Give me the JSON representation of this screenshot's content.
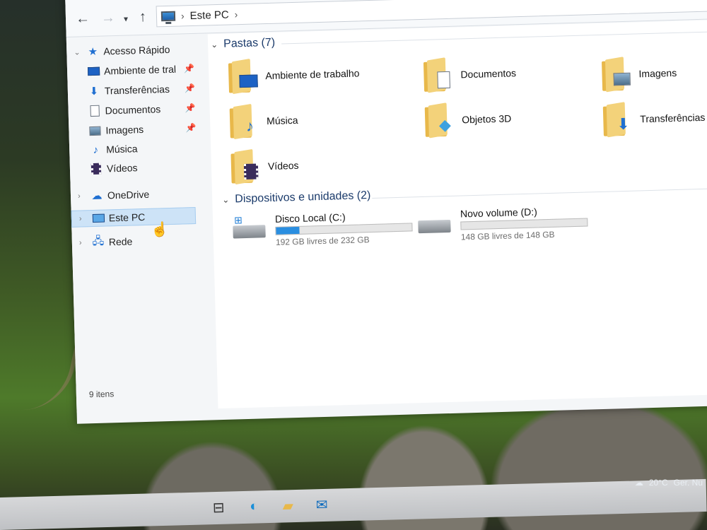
{
  "breadcrumb": {
    "location": "Este PC"
  },
  "sidebar": {
    "quick_access": "Acesso Rápido",
    "items": [
      {
        "label": "Ambiente de tral",
        "icon": "desktop-icon",
        "pinned": true
      },
      {
        "label": "Transferências",
        "icon": "download-icon",
        "pinned": true
      },
      {
        "label": "Documentos",
        "icon": "document-icon",
        "pinned": true
      },
      {
        "label": "Imagens",
        "icon": "pictures-icon",
        "pinned": true
      },
      {
        "label": "Música",
        "icon": "music-icon",
        "pinned": false
      },
      {
        "label": "Vídeos",
        "icon": "videos-icon",
        "pinned": false
      }
    ],
    "onedrive": "OneDrive",
    "este_pc": "Este PC",
    "rede": "Rede"
  },
  "main": {
    "folders_header": "Pastas (7)",
    "folders": [
      {
        "label": "Ambiente de trabalho",
        "icon": "desktop-folder-icon"
      },
      {
        "label": "Documentos",
        "icon": "documents-folder-icon"
      },
      {
        "label": "Imagens",
        "icon": "pictures-folder-icon"
      },
      {
        "label": "Música",
        "icon": "music-folder-icon"
      },
      {
        "label": "Objetos 3D",
        "icon": "3d-objects-folder-icon"
      },
      {
        "label": "Transferências",
        "icon": "downloads-folder-icon"
      },
      {
        "label": "Vídeos",
        "icon": "videos-folder-icon"
      }
    ],
    "devices_header": "Dispositivos e unidades (2)",
    "drives": [
      {
        "label": "Disco Local (C:)",
        "free": "192 GB livres de 232 GB",
        "used_fraction": 0.17,
        "icon": "system-drive-icon"
      },
      {
        "label": "Novo volume (D:)",
        "free": "148 GB livres de 148 GB",
        "used_fraction": 0.0,
        "icon": "drive-icon"
      }
    ]
  },
  "status": {
    "item_count": "9 itens"
  },
  "tray": {
    "temperature": "20°C",
    "weather": "Ger. Nu"
  },
  "colors": {
    "accent": "#2a8ee0",
    "folder": "#f3d27a",
    "selection": "#cde3f7"
  }
}
